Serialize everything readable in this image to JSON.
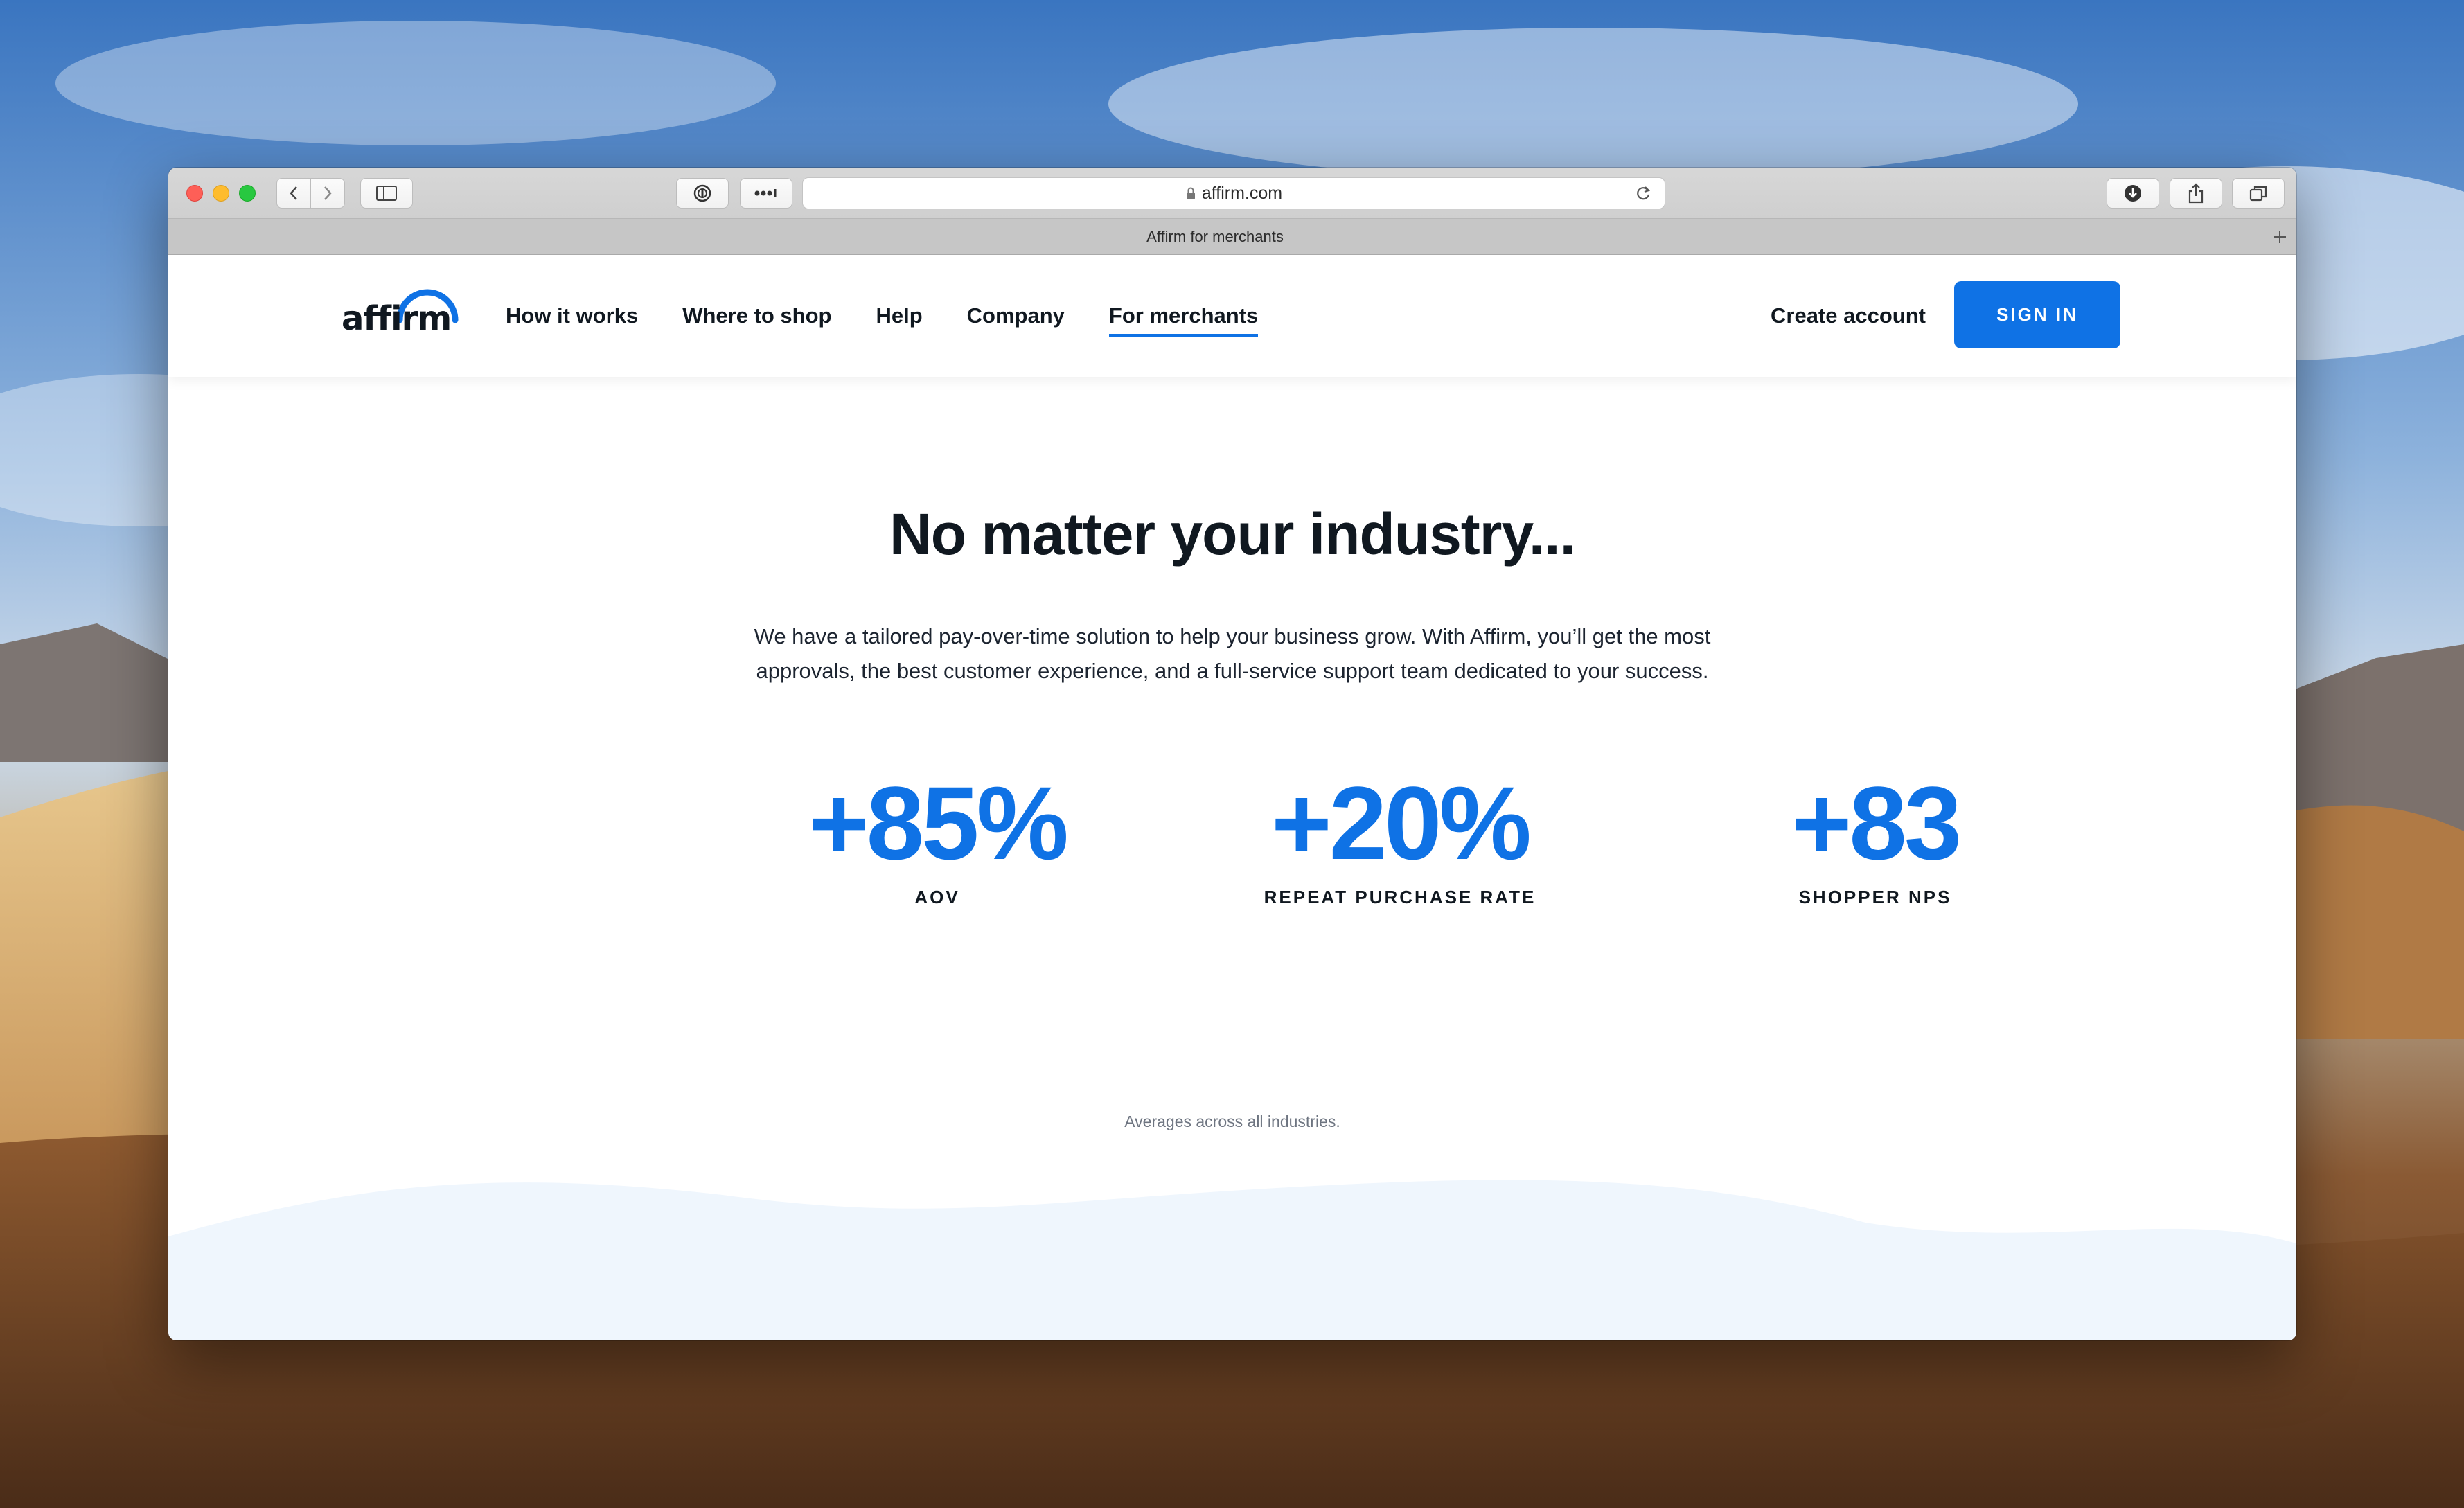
{
  "browser": {
    "url": "affirm.com",
    "tab_title": "Affirm for merchants"
  },
  "nav": {
    "logo": "affirm",
    "links": [
      "How it works",
      "Where to shop",
      "Help",
      "Company",
      "For merchants"
    ],
    "active_link": "For merchants",
    "create_account": "Create account",
    "sign_in": "SIGN IN"
  },
  "hero": {
    "headline": "No matter your industry...",
    "subtext": "We have a tailored pay-over-time solution to help your business grow. With Affirm, you’ll get the most approvals, the best customer experience, and a full-service support team dedicated to your success."
  },
  "stats": [
    {
      "value": "+85%",
      "label": "AOV"
    },
    {
      "value": "+20%",
      "label": "REPEAT PURCHASE RATE"
    },
    {
      "value": "+83",
      "label": "SHOPPER NPS"
    }
  ],
  "footnote": "Averages across all industries.",
  "colors": {
    "brand_blue": "#0f72e5",
    "text_dark": "#101820",
    "wave_fill": "#eff6fd"
  }
}
